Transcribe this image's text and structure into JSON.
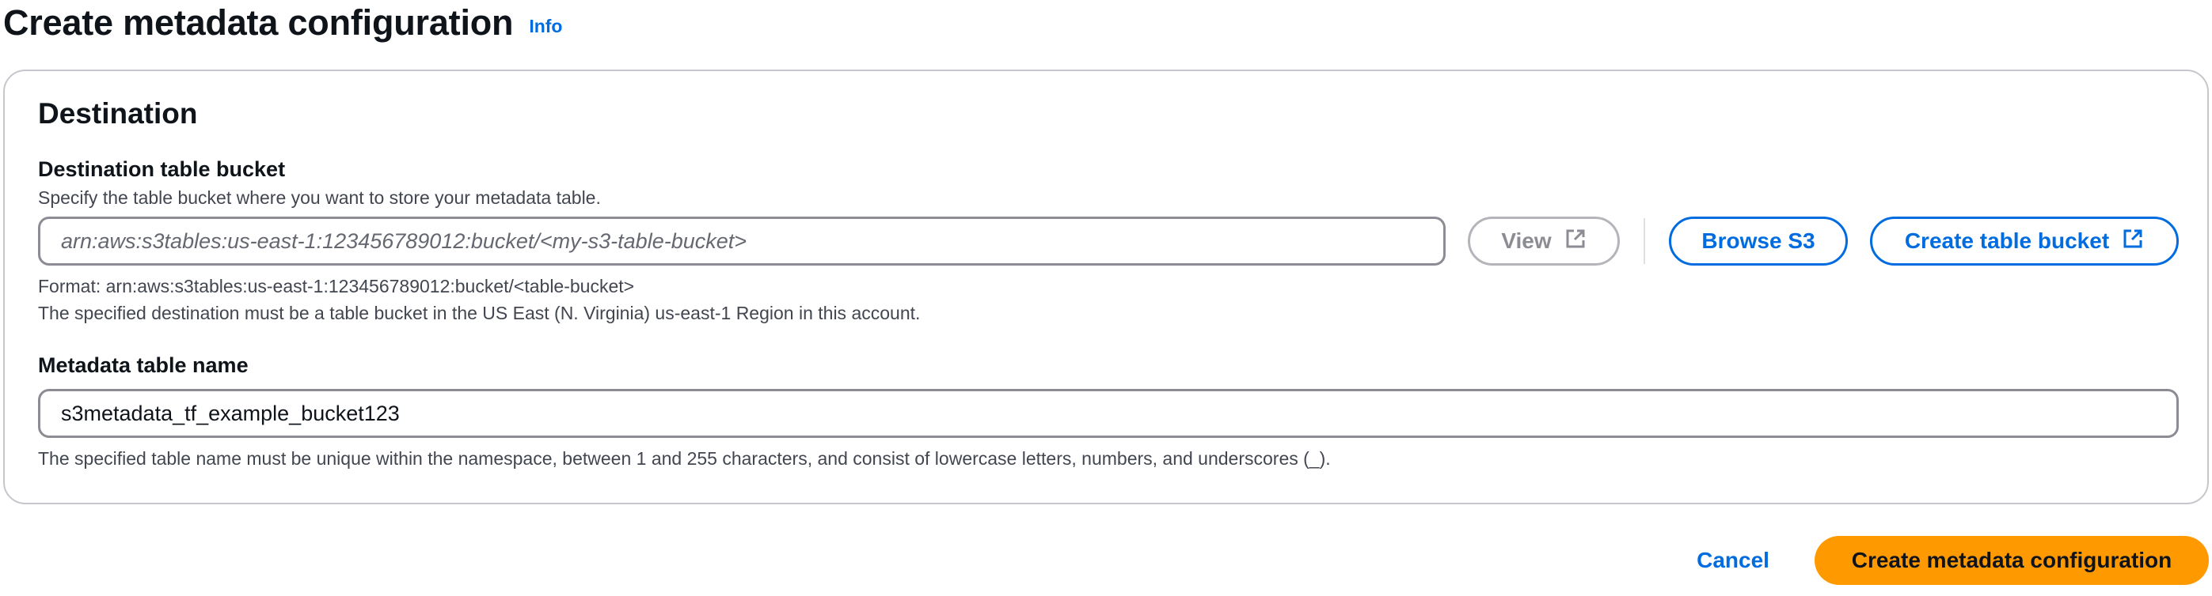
{
  "header": {
    "title": "Create metadata configuration",
    "info_label": "Info"
  },
  "destination": {
    "heading": "Destination",
    "bucket_field": {
      "label": "Destination table bucket",
      "description": "Specify the table bucket where you want to store your metadata table.",
      "placeholder": "arn:aws:s3tables:us-east-1:123456789012:bucket/<my-s3-table-bucket>",
      "value": "",
      "hint_format": "Format: arn:aws:s3tables:us-east-1:123456789012:bucket/<table-bucket>",
      "hint_region": "The specified destination must be a table bucket in the US East (N. Virginia) us-east-1 Region in this account."
    },
    "buttons": {
      "view_label": "View",
      "browse_label": "Browse S3",
      "create_bucket_label": "Create table bucket"
    },
    "table_name_field": {
      "label": "Metadata table name",
      "value": "s3metadata_tf_example_bucket123",
      "hint": "The specified table name must be unique within the namespace, between 1 and 255 characters, and consist of lowercase letters, numbers, and underscores (_)."
    }
  },
  "footer": {
    "cancel_label": "Cancel",
    "submit_label": "Create metadata configuration"
  },
  "icons": {
    "external_link": "external-link-icon"
  },
  "colors": {
    "primary_button": "#ff9900",
    "link": "#006ce0",
    "border": "#c6c6cd"
  }
}
